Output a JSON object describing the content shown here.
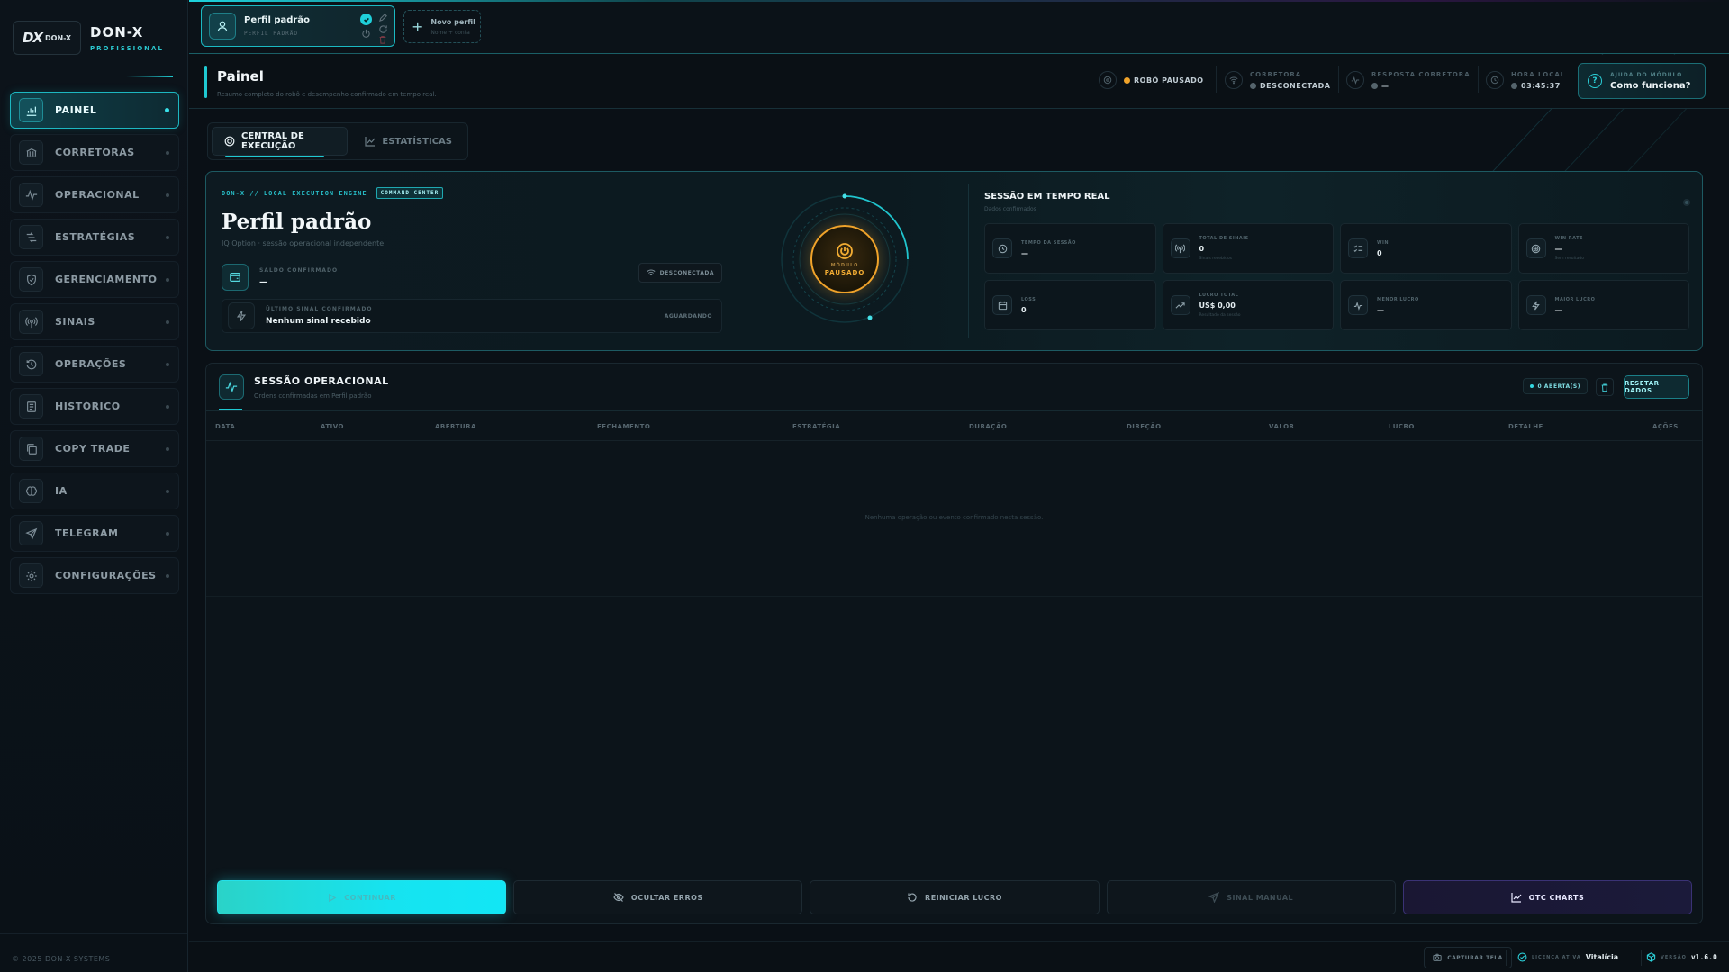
{
  "brand": {
    "logo_text": "DX",
    "logo_sub": "DON-X",
    "name": "DON-X",
    "tagline": "PROFISSIONAL"
  },
  "sidebar": {
    "items": [
      {
        "label": "PAINEL",
        "icon": "chart-icon",
        "active": true
      },
      {
        "label": "CORRETORAS",
        "icon": "bank-icon"
      },
      {
        "label": "OPERACIONAL",
        "icon": "pulse-icon"
      },
      {
        "label": "ESTRATÉGIAS",
        "icon": "strategy-icon"
      },
      {
        "label": "GERENCIAMENTO",
        "icon": "shield-icon"
      },
      {
        "label": "SINAIS",
        "icon": "signal-icon"
      },
      {
        "label": "OPERAÇÕES",
        "icon": "history-clock-icon"
      },
      {
        "label": "HISTÓRICO",
        "icon": "ledger-icon"
      },
      {
        "label": "COPY TRADE",
        "icon": "copy-icon"
      },
      {
        "label": "IA",
        "icon": "brain-icon"
      },
      {
        "label": "TELEGRAM",
        "icon": "send-icon"
      },
      {
        "label": "CONFIGURAÇÕES",
        "icon": "gear-icon"
      }
    ],
    "footer": "© 2025 DON-X SYSTEMS"
  },
  "profiles": {
    "active": {
      "name": "Perfil padrão",
      "sub": "PERFIL PADRÃO"
    },
    "new": {
      "title": "Novo perfil",
      "sub": "Nome + conta"
    }
  },
  "header": {
    "title": "Painel",
    "subtitle": "Resumo completo do robô e desempenho confirmado em tempo real.",
    "robot_status": "ROBÔ PAUSADO",
    "broker_label": "CORRETORA",
    "broker_value": "DESCONECTADA",
    "response_label": "RESPOSTA CORRETORA",
    "response_value": "—",
    "time_label": "HORA LOCAL",
    "time_value": "03:45:37",
    "help_label": "AJUDA DO MÓDULO",
    "help_value": "Como funciona?"
  },
  "tabs": [
    {
      "label": "CENTRAL DE EXECUÇÃO",
      "active": true
    },
    {
      "label": "ESTATÍSTICAS"
    }
  ],
  "hero": {
    "tag": "DON-X // LOCAL EXECUTION ENGINE",
    "badge": "COMMAND CENTER",
    "title": "Perfil padrão",
    "subtitle": "IQ Option · sessão operacional independente",
    "balance_label": "SALDO CONFIRMADO",
    "balance_value": "—",
    "connection_chip": "DESCONECTADA",
    "signal_label": "ÚLTIMO SINAL CONFIRMADO",
    "signal_value": "Nenhum sinal recebido",
    "signal_status": "AGUARDANDO",
    "power_label": "MÓDULO",
    "power_state": "PAUSADO"
  },
  "realtime": {
    "title": "SESSÃO EM TEMPO REAL",
    "subtitle": "Dados confirmados",
    "stats": [
      {
        "label": "TEMPO DA SESSÃO",
        "value": "—",
        "note": "",
        "icon": "clock-icon"
      },
      {
        "label": "TOTAL DE SINAIS",
        "value": "0",
        "note": "Sinais recebidos",
        "icon": "antenna-icon"
      },
      {
        "label": "WIN",
        "value": "0",
        "note": "",
        "icon": "checklist-icon"
      },
      {
        "label": "WIN RATE",
        "value": "—",
        "note": "Sem resultado",
        "icon": "target-icon"
      },
      {
        "label": "LOSS",
        "value": "0",
        "note": "",
        "icon": "calendar-icon"
      },
      {
        "label": "LUCRO TOTAL",
        "value": "US$ 0,00",
        "note": "Resultado da sessão",
        "icon": "trend-up-icon"
      },
      {
        "label": "MENOR LUCRO",
        "value": "—",
        "note": "",
        "icon": "pulse-icon"
      },
      {
        "label": "MAIOR LUCRO",
        "value": "—",
        "note": "",
        "icon": "bolt-icon"
      }
    ]
  },
  "session": {
    "title": "SESSÃO OPERACIONAL",
    "subtitle": "Ordens confirmadas em Perfil padrão",
    "open_chip": "0 ABERTA(S)",
    "reset_label": "RESETAR DADOS",
    "columns": [
      "DATA",
      "ATIVO",
      "ABERTURA",
      "FECHAMENTO",
      "ESTRATÉGIA",
      "DURAÇÃO",
      "DIREÇÃO",
      "VALOR",
      "LUCRO",
      "DETALHE",
      "AÇÕES"
    ],
    "empty_text": "Nenhuma operação ou evento confirmado nesta sessão."
  },
  "actions": {
    "start": "CONTINUAR",
    "hide_errors": "OCULTAR ERROS",
    "reset_profit": "REINICIAR LUCRO",
    "manual_signal": "SINAL MANUAL",
    "otc": "OTC CHARTS"
  },
  "footer": {
    "capture": "CAPTURAR TELA",
    "license_label": "LICENÇA ATIVA",
    "license_value": "Vitalícia",
    "version_label": "VERSÃO",
    "version_value": "v1.6.0"
  },
  "colors": {
    "accent": "#1fc9d2",
    "warning": "#f0a32a",
    "disconnected": "#55646c",
    "otc": "#3a3275"
  }
}
